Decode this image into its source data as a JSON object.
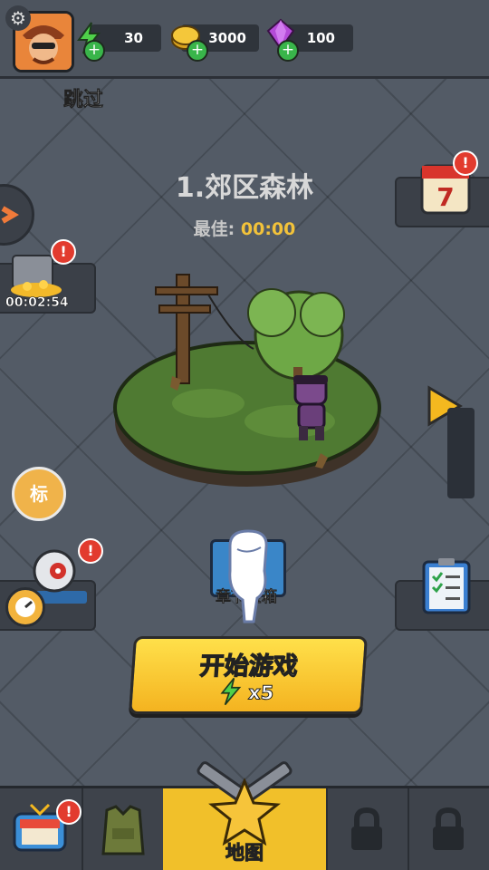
{
  "header": {
    "energy": "30",
    "gold": "3000",
    "gems": "100"
  },
  "skip_label": "跳过",
  "level": {
    "title": "1.郊区森林",
    "best_label": "最佳:",
    "best_time": "00:00"
  },
  "left_panels": {
    "treasure_timer": "00:02:54",
    "tag_icon_text": "标"
  },
  "chapter_chest_label": "章节宝箱",
  "start_button": {
    "label": "开始游戏",
    "cost": "x5"
  },
  "nav": {
    "map_label": "地图"
  },
  "badges": {
    "alert": "!"
  },
  "colors": {
    "accent_yellow": "#f4c02a",
    "alert_red": "#e23b2e",
    "plus_green": "#39b54a",
    "energy_green": "#4fd14a",
    "gem_purple": "#b44bd8"
  }
}
